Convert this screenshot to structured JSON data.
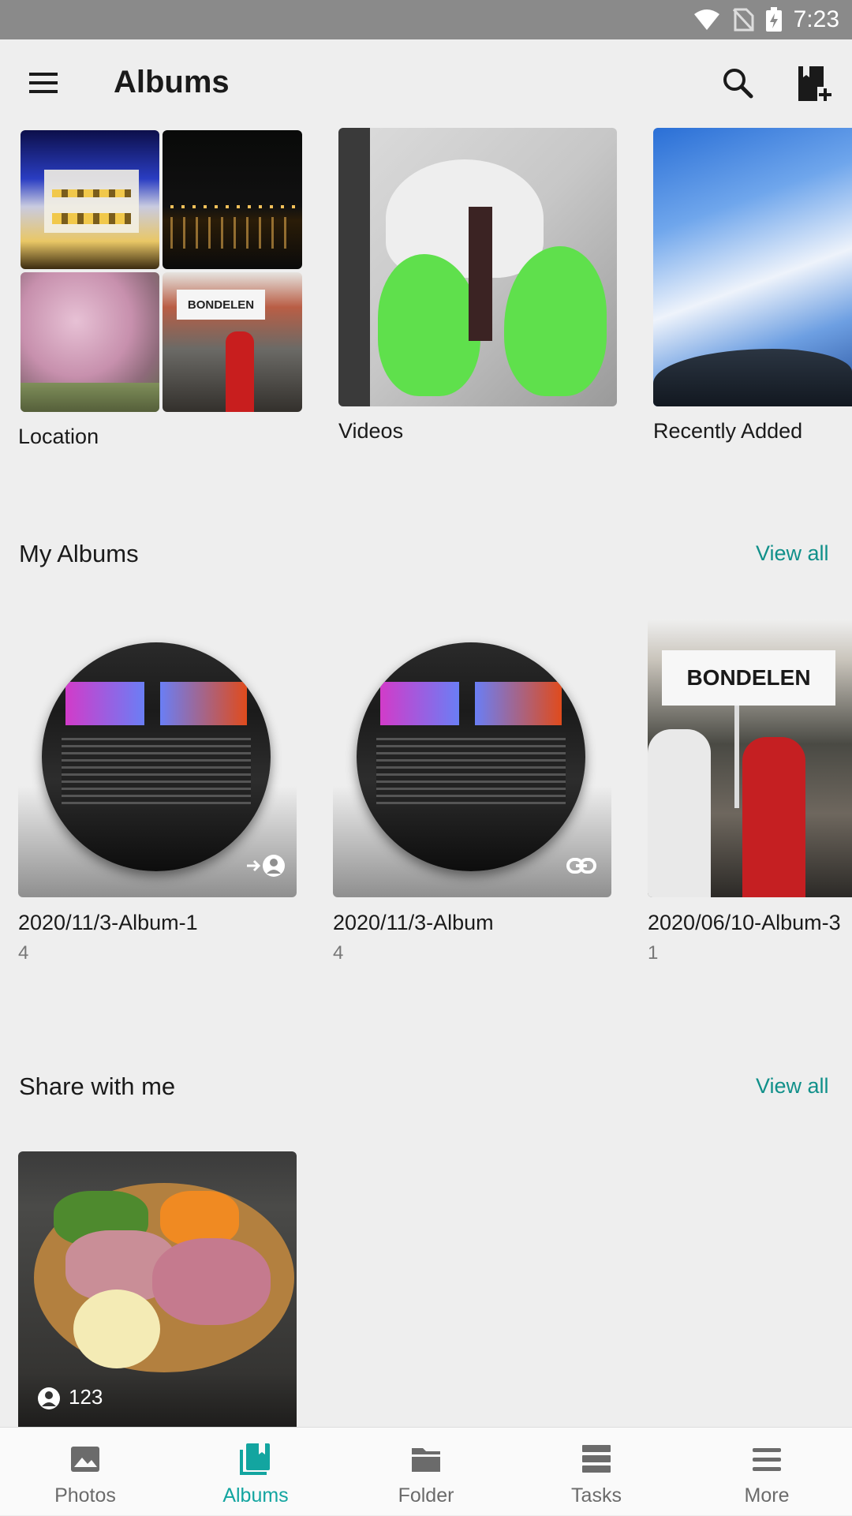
{
  "status_bar": {
    "time": "7:23"
  },
  "app_bar": {
    "title": "Albums"
  },
  "top_albums": [
    {
      "label": "Location"
    },
    {
      "label": "Videos"
    },
    {
      "label": "Recently Added"
    }
  ],
  "my_albums": {
    "title": "My Albums",
    "view_all": "View all",
    "items": [
      {
        "name": "2020/11/3-Album-1",
        "count": "4",
        "badge_icon": "shared-to-person-icon"
      },
      {
        "name": "2020/11/3-Album",
        "count": "4",
        "badge_icon": "link-icon"
      },
      {
        "name": "2020/06/10-Album-3",
        "count": "1"
      }
    ]
  },
  "share_with_me": {
    "title": "Share with me",
    "view_all": "View all",
    "items": [
      {
        "member_count": "123"
      }
    ]
  },
  "bottom_nav": {
    "items": [
      {
        "label": "Photos",
        "icon": "photos-icon"
      },
      {
        "label": "Albums",
        "icon": "albums-icon",
        "active": true
      },
      {
        "label": "Folder",
        "icon": "folder-icon"
      },
      {
        "label": "Tasks",
        "icon": "tasks-icon"
      },
      {
        "label": "More",
        "icon": "more-icon"
      }
    ]
  },
  "colors": {
    "accent": "#13a5a0",
    "link": "#11908a",
    "status_bar": "#8a8a8a",
    "background": "#eeeeee"
  }
}
